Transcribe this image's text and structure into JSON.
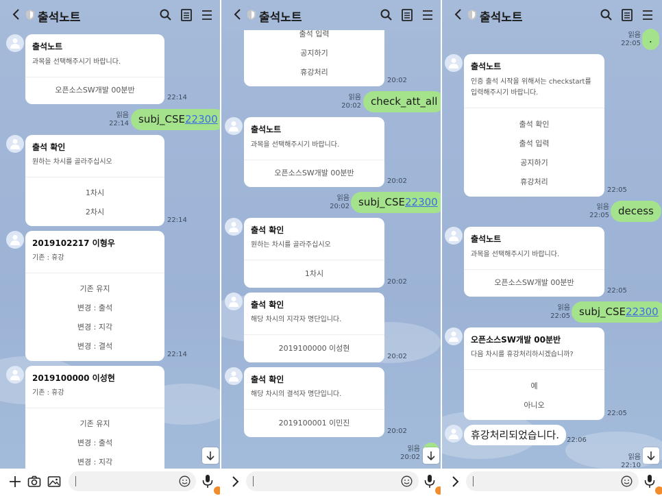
{
  "app_title": "출석노트",
  "colors": {
    "chat_bg": "#a6bad9",
    "my_bubble": "#a4e28c",
    "link": "#3b6ee0"
  },
  "panel1": {
    "cards": [
      {
        "title": "출석노트",
        "subtitle": "과목을 선택해주시기 바랍니다.",
        "options": [
          "오픈소스SW개발 00분반"
        ],
        "time": "22:14"
      },
      {
        "title": "출석 확인",
        "subtitle": "원하는 차시를 골라주십시오",
        "options": [
          "1차시",
          "2차시"
        ],
        "time": "22:14"
      },
      {
        "title": "2019102217 이형우",
        "subtitle": "기존 : 휴강",
        "options": [
          "기존 유지",
          "변경 : 출석",
          "변경 : 지각",
          "변경 : 결석"
        ],
        "time": "22:14"
      },
      {
        "title": "2019100000 이성현",
        "subtitle": "기존 : 휴강",
        "options": [
          "기존 유지",
          "변경 : 출석",
          "변경 : 지각"
        ]
      }
    ],
    "my_message": {
      "read": "읽음",
      "time": "22:14",
      "text_prefix": "subj_CSE",
      "text_link": "22300"
    }
  },
  "panel2": {
    "top_card": {
      "options": [
        "출석 입력",
        "공지하기",
        "휴강처리"
      ],
      "time": "20:02"
    },
    "my_message_1": {
      "read": "읽음",
      "time": "20:02",
      "text": "check_att_all"
    },
    "cards": [
      {
        "title": "출석노트",
        "subtitle": "과목을 선택해주시기 바랍니다.",
        "options": [
          "오픈소스SW개발 00분반"
        ],
        "time": "20:02"
      },
      {
        "title": "출석 확인",
        "subtitle": "원하는 차시를 골라주십시오",
        "options": [
          "1차시"
        ],
        "time": "20:02"
      },
      {
        "title": "출석 확인",
        "subtitle": "해당 차시의 지각자 명단입니다.",
        "options": [
          "2019100000 이성현"
        ],
        "time": "20:02"
      },
      {
        "title": "출석 확인",
        "subtitle": "해당 차시의 결석자 명단입니다.",
        "options": [
          "2019100001 이민진"
        ],
        "time": "20:02"
      }
    ],
    "my_message_2": {
      "read": "읽음",
      "time": "20:02",
      "text_prefix": "subj_CSE",
      "text_link": "22300"
    },
    "bottom_read": {
      "read": "읽음",
      "time": "20:02"
    }
  },
  "panel3": {
    "my_message_dot": {
      "read": "읽음",
      "time": "22:05",
      "text": "."
    },
    "cards": [
      {
        "title": "출석노트",
        "subtitle_1": "인증 출석 시작을 위해서는 checkstart를",
        "subtitle_2": "입력해주시기 바랍니다.",
        "options": [
          "출석 확인",
          "출석 입력",
          "공지하기",
          "휴강처리"
        ],
        "time": "22:05"
      },
      {
        "title": "출석노트",
        "subtitle": "과목을 선택해주시기 바랍니다.",
        "options": [
          "오픈소스SW개발 00분반"
        ],
        "time": "22:05"
      },
      {
        "title": "오픈소스SW개발 00분반",
        "subtitle": "다음 차시를 휴강처리하시겠습니까?",
        "options": [
          "예",
          "아니오"
        ],
        "time": "22:05"
      }
    ],
    "my_message_decess": {
      "read": "읽음",
      "time": "22:05",
      "text": "decess"
    },
    "my_message_subj": {
      "read": "읽음",
      "time": "22:05",
      "text_prefix": "subj_CSE",
      "text_link": "22300"
    },
    "bot_reply": {
      "text": "휴강처리되었습니다.",
      "time": "22:06"
    },
    "bottom_read": {
      "read": "읽음",
      "time": "22:10"
    }
  }
}
